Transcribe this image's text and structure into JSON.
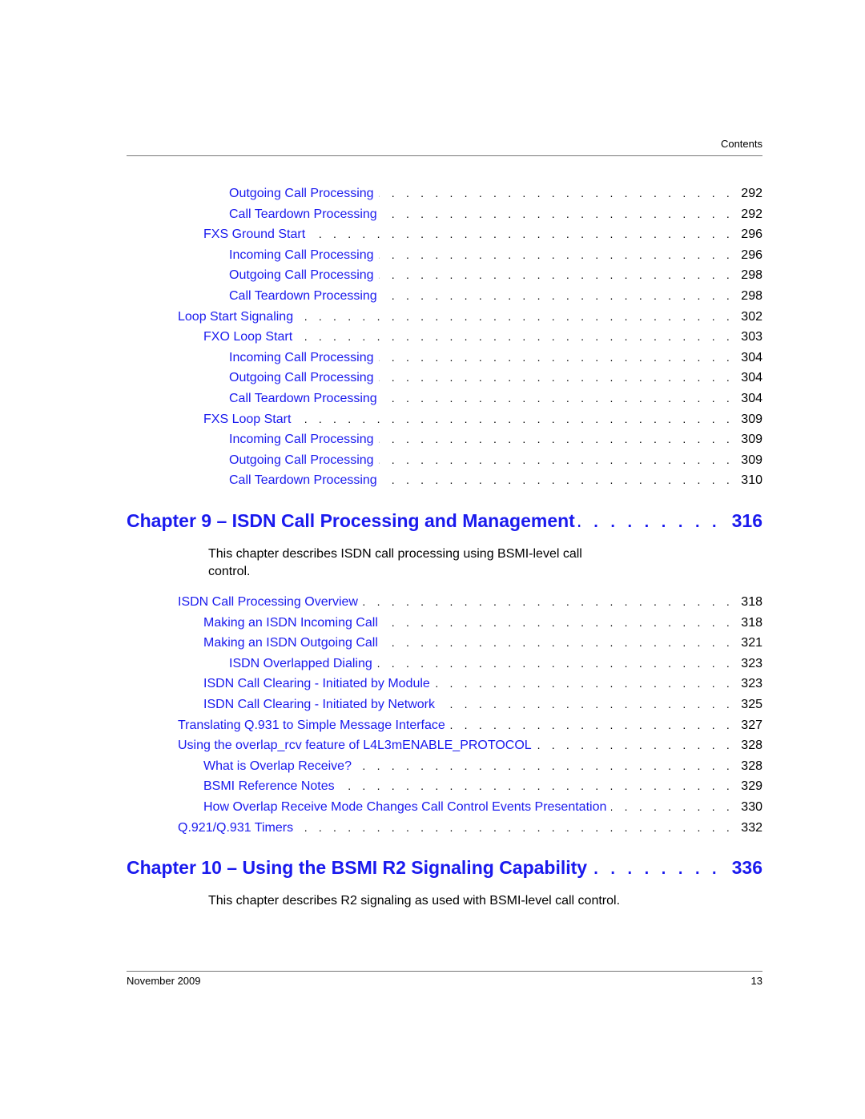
{
  "header": {
    "label": "Contents"
  },
  "toc_upper": [
    {
      "level": 3,
      "title": "Outgoing Call Processing",
      "page": "292"
    },
    {
      "level": 3,
      "title": "Call Teardown Processing",
      "page": "292"
    },
    {
      "level": 2,
      "title": "FXS Ground Start",
      "page": "296"
    },
    {
      "level": 3,
      "title": "Incoming Call Processing",
      "page": "296"
    },
    {
      "level": 3,
      "title": "Outgoing Call Processing",
      "page": "298"
    },
    {
      "level": 3,
      "title": "Call Teardown Processing",
      "page": "298"
    },
    {
      "level": 1,
      "title": "Loop Start Signaling",
      "page": "302"
    },
    {
      "level": 2,
      "title": "FXO Loop Start",
      "page": "303"
    },
    {
      "level": 3,
      "title": "Incoming Call Processing",
      "page": "304"
    },
    {
      "level": 3,
      "title": "Outgoing Call Processing",
      "page": "304"
    },
    {
      "level": 3,
      "title": "Call Teardown Processing",
      "page": "304"
    },
    {
      "level": 2,
      "title": "FXS Loop Start",
      "page": "309"
    },
    {
      "level": 3,
      "title": "Incoming Call Processing",
      "page": "309"
    },
    {
      "level": 3,
      "title": "Outgoing Call Processing",
      "page": "309"
    },
    {
      "level": 3,
      "title": "Call Teardown Processing",
      "page": "310"
    }
  ],
  "chapter9": {
    "title": "Chapter 9 – ISDN Call Processing and Management",
    "page": "316",
    "description_line1": "This chapter describes ISDN call processing using BSMI-level call",
    "description_line2": "control.",
    "entries": [
      {
        "level": 1,
        "title": "ISDN Call Processing Overview",
        "page": "318"
      },
      {
        "level": 2,
        "title": "Making an ISDN Incoming Call",
        "page": "318"
      },
      {
        "level": 2,
        "title": "Making an ISDN Outgoing Call",
        "page": "321"
      },
      {
        "level": 3,
        "title": "ISDN Overlapped Dialing",
        "page": "323"
      },
      {
        "level": 2,
        "title": "ISDN Call Clearing - Initiated by Module",
        "page": "323"
      },
      {
        "level": 2,
        "title": "ISDN Call Clearing - Initiated by Network",
        "page": "325"
      },
      {
        "level": 1,
        "title": "Translating Q.931 to Simple Message Interface",
        "page": "327"
      },
      {
        "level": 1,
        "title": "Using the overlap_rcv feature of L4L3mENABLE_PROTOCOL",
        "page": "328"
      },
      {
        "level": 2,
        "title": "What is Overlap Receive?",
        "page": "328"
      },
      {
        "level": 2,
        "title": "BSMI Reference Notes",
        "page": "329"
      },
      {
        "level": 2,
        "title": "How Overlap Receive Mode Changes Call Control Events Presentation",
        "page": "330"
      },
      {
        "level": 1,
        "title": "Q.921/Q.931 Timers",
        "page": "332"
      }
    ]
  },
  "chapter10": {
    "title": "Chapter 10 – Using the BSMI R2 Signaling Capability",
    "page": "336",
    "description": "This chapter describes R2 signaling as used with BSMI-level call control."
  },
  "footer": {
    "date": "November 2009",
    "page_number": "13"
  },
  "colors": {
    "link": "#1a1aee",
    "text": "#000000",
    "rule": "#777777"
  }
}
